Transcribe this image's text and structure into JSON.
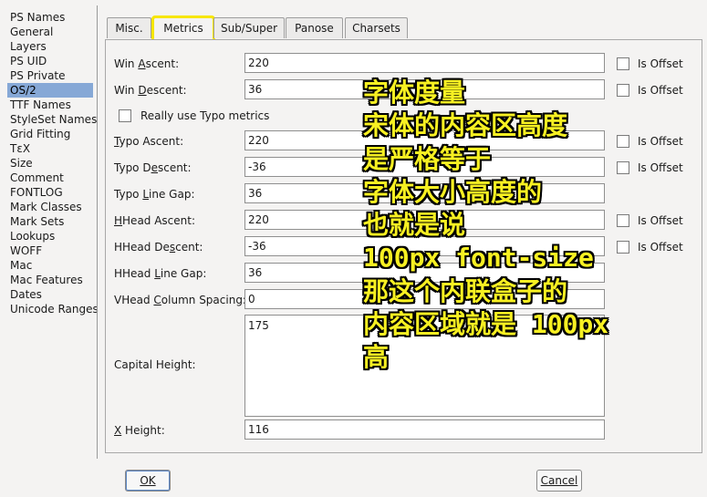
{
  "sidebar": {
    "items": [
      {
        "label": "PS Names"
      },
      {
        "label": "General"
      },
      {
        "label": "Layers"
      },
      {
        "label": "PS UID"
      },
      {
        "label": "PS Private"
      },
      {
        "label": "OS/2",
        "selected": true
      },
      {
        "label": "TTF Names"
      },
      {
        "label": "StyleSet Names"
      },
      {
        "label": "Grid Fitting"
      },
      {
        "label": "TεX"
      },
      {
        "label": "Size"
      },
      {
        "label": "Comment"
      },
      {
        "label": "FONTLOG"
      },
      {
        "label": "Mark Classes"
      },
      {
        "label": "Mark Sets"
      },
      {
        "label": "Lookups"
      },
      {
        "label": "WOFF"
      },
      {
        "label": "Mac"
      },
      {
        "label": "Mac Features"
      },
      {
        "label": "Dates"
      },
      {
        "label": "Unicode Ranges"
      }
    ]
  },
  "tabs": [
    {
      "label": "Misc."
    },
    {
      "label": "Metrics",
      "active": true,
      "highlighted": true
    },
    {
      "label": "Sub/Super"
    },
    {
      "label": "Panose"
    },
    {
      "label": "Charsets"
    }
  ],
  "metrics": {
    "win_ascent": {
      "pre": "Win ",
      "u": "A",
      "post": "scent:",
      "value": "220"
    },
    "win_descent": {
      "pre": "Win ",
      "u": "D",
      "post": "escent:",
      "value": "36"
    },
    "really_use_typo": {
      "label": "Really use Typo metrics",
      "checked": false
    },
    "typo_ascent": {
      "pre": "",
      "u": "T",
      "post": "ypo Ascent:",
      "value": "220"
    },
    "typo_descent": {
      "pre": "Typo D",
      "u": "e",
      "post": "scent:",
      "value": "-36"
    },
    "typo_line_gap": {
      "pre": "Typo ",
      "u": "L",
      "post": "ine Gap:",
      "value": "36"
    },
    "hhead_ascent": {
      "pre": "",
      "u": "H",
      "post": "Head Ascent:",
      "value": "220"
    },
    "hhead_descent": {
      "pre": "HHead De",
      "u": "s",
      "post": "cent:",
      "value": "-36"
    },
    "hhead_line_gap": {
      "pre": "HHead ",
      "u": "L",
      "post": "ine Gap:",
      "value": "36"
    },
    "vhead_column_spacing": {
      "pre": "VHead ",
      "u": "C",
      "post": "olumn Spacing:",
      "value": "0"
    },
    "capital_height": {
      "label": "Capital Height:",
      "value": "175"
    },
    "x_height": {
      "pre": "",
      "u": "X",
      "post": " Height:",
      "value": "116"
    },
    "is_offset_label": "Is Offset"
  },
  "buttons": {
    "ok": "OK",
    "cancel": "Cancel"
  },
  "overlay": {
    "lines": [
      "字体度量",
      "宋体的内容区高度",
      "是严格等于",
      "字体大小高度的",
      "也就是说",
      "100px font-size",
      "那这个内联盒子的",
      "内容区域就是 100px",
      "高"
    ],
    "color": "#f7f022"
  }
}
